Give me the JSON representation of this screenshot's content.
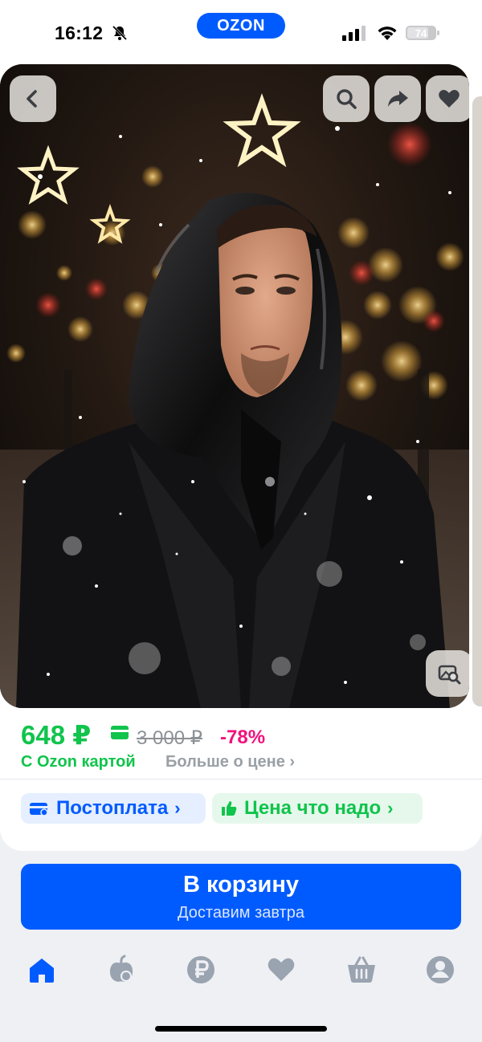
{
  "status_bar": {
    "time": "16:12",
    "brand": "OZON",
    "battery_level": "74",
    "icons": [
      "bell-muted-icon",
      "signal-icon",
      "wifi-icon",
      "battery-icon"
    ]
  },
  "product_photo": {
    "overlay_buttons": [
      "back-icon",
      "search-icon",
      "share-icon",
      "heart-icon",
      "image-search-icon"
    ]
  },
  "price": {
    "current": "648 ₽",
    "old": "3 000 ₽",
    "discount": "-78%",
    "ozon_card_label": "С Ozon картой",
    "more_label": "Больше о цене ›"
  },
  "chips": {
    "postpay": "Постоплата",
    "good_price": "Цена что надо"
  },
  "cart": {
    "label": "В корзину",
    "sub": "Доставим завтра"
  },
  "nav": [
    "home-icon",
    "fresh-icon",
    "ruble-icon",
    "favorites-icon",
    "basket-icon",
    "profile-icon"
  ],
  "colors": {
    "brand_blue": "#005bff",
    "price_green": "#10c44c",
    "discount_pink": "#f1117e",
    "old_price_grey": "#8c9196"
  }
}
